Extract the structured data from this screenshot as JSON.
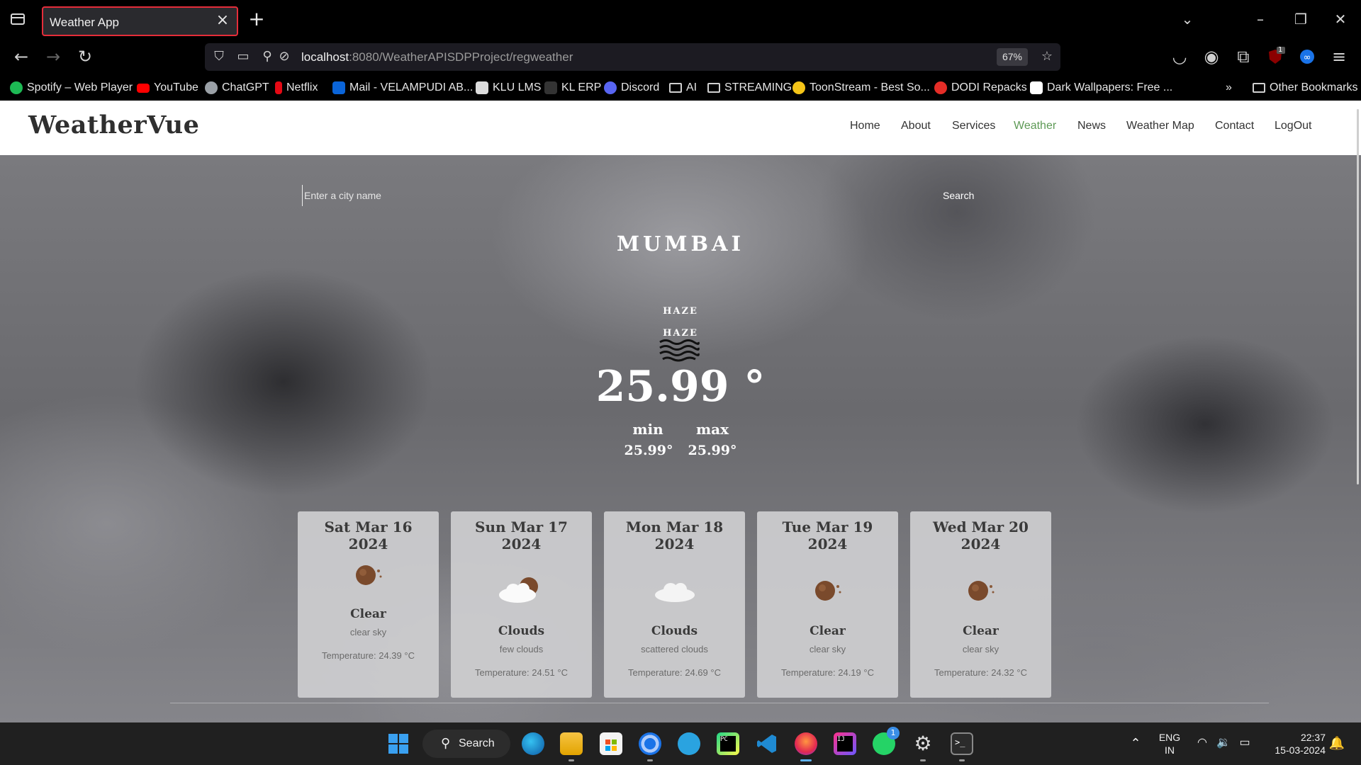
{
  "browser": {
    "tab_title": "Weather App",
    "url_host": "localhost",
    "url_rest": ":8080/WeatherAPISDPProject/regweather",
    "zoom": "67%",
    "extension_badge": "1",
    "bookmarks": [
      {
        "label": "Spotify – Web Player",
        "color": "#1db954"
      },
      {
        "label": "YouTube",
        "color": "#ff0000"
      },
      {
        "label": "ChatGPT",
        "color": "#9aa0a6"
      },
      {
        "label": "Netflix",
        "color": "#e50914"
      },
      {
        "label": "Mail - VELAMPUDI AB...",
        "color": "#0a64d8"
      },
      {
        "label": "KLU LMS",
        "color": "#dddddd"
      },
      {
        "label": "KL ERP",
        "color": "#333333"
      },
      {
        "label": "Discord",
        "color": "#5865f2"
      },
      {
        "label": "AI",
        "folder": true
      },
      {
        "label": "STREAMING",
        "folder": true
      },
      {
        "label": "ToonStream - Best So...",
        "color": "#f5c518"
      },
      {
        "label": "DODI Repacks",
        "color": "#e52d27"
      },
      {
        "label": "Dark Wallpapers: Free ...",
        "color": "#ffffff"
      }
    ],
    "other_bookmarks": "Other Bookmarks"
  },
  "site": {
    "brand": "WeatherVue",
    "menu": [
      "Home",
      "About",
      "Services",
      "Weather",
      "News",
      "Weather Map",
      "Contact",
      "LogOut"
    ],
    "active_menu": "Weather"
  },
  "search": {
    "placeholder": "Enter a city name",
    "button": "Search"
  },
  "current": {
    "city": "MUMBAI",
    "main": "HAZE",
    "description": "HAZE",
    "icon": "haze-icon",
    "temp": "25.99 °",
    "min_label": "min",
    "max_label": "max",
    "min": "25.99°",
    "max": "25.99°"
  },
  "forecast": [
    {
      "date": "Sat Mar 16 2024",
      "main": "Clear",
      "desc": "clear sky",
      "temp": "Temperature: 24.39 °C",
      "icon": "clear-sun-icon"
    },
    {
      "date": "Sun Mar 17 2024",
      "main": "Clouds",
      "desc": "few clouds",
      "temp": "Temperature: 24.51 °C",
      "icon": "few-clouds-icon"
    },
    {
      "date": "Mon Mar 18 2024",
      "main": "Clouds",
      "desc": "scattered clouds",
      "temp": "Temperature: 24.69 °C",
      "icon": "scattered-clouds-icon"
    },
    {
      "date": "Tue Mar 19 2024",
      "main": "Clear",
      "desc": "clear sky",
      "temp": "Temperature: 24.19 °C",
      "icon": "clear-sun-icon"
    },
    {
      "date": "Wed Mar 20 2024",
      "main": "Clear",
      "desc": "clear sky",
      "temp": "Temperature: 24.32 °C",
      "icon": "clear-sun-icon"
    }
  ],
  "taskbar": {
    "search_label": "Search",
    "lang_line1": "ENG",
    "lang_line2": "IN",
    "time": "22:37",
    "date": "15-03-2024",
    "whatsapp_badge": "1"
  },
  "colors": {
    "accent_active": "#5e9a56",
    "tab_border": "#e52d3a"
  }
}
